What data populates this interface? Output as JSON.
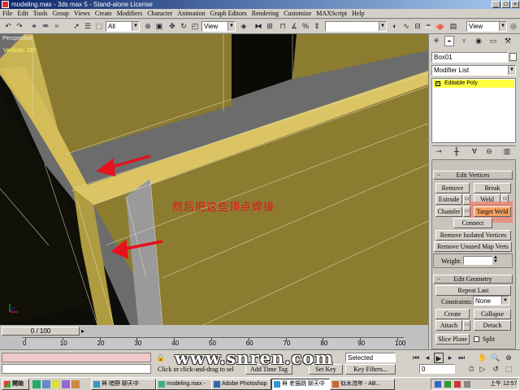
{
  "window": {
    "title": "modeling.max - 3ds max 5 - Stand-alone License"
  },
  "menu": [
    "File",
    "Edit",
    "Tools",
    "Group",
    "Views",
    "Create",
    "Modifiers",
    "Character",
    "Animation",
    "Graph Editors",
    "Rendering",
    "Customize",
    "MAXScript",
    "Help"
  ],
  "toolbar": {
    "selection_filter": "All",
    "ref_coord": "View",
    "named_sel": "",
    "view_dropdown": "View"
  },
  "viewport": {
    "label": "Perspective",
    "vertex_count": "Vertices: 167",
    "annotation": "然后把这些顶点焊接"
  },
  "panel": {
    "object_name": "Box01",
    "modifier_list": "Modifier List",
    "stack_item": "Editable Poly",
    "edit_vertices": {
      "header": "Edit Vertices",
      "remove": "Remove",
      "break": "Break",
      "extrude": "Extrude",
      "weld": "Weld",
      "chamfer": "Chamfer",
      "target_weld": "Target Weld",
      "connect": "Connect",
      "remove_isolated": "Remove Isolated Vertices",
      "remove_unused": "Remove Unused Map Verts",
      "weight_label": "Weight:"
    },
    "edit_geometry": {
      "header": "Edit Geometry",
      "repeat_last": "Repeat Last",
      "constraints_label": "Constraints:",
      "constraints_value": "None",
      "create": "Create",
      "collapse": "Collapse",
      "attach": "Attach",
      "detach": "Detach",
      "slice_plane": "Slice Plane",
      "split": "Split"
    }
  },
  "timeline": {
    "slider": "0 / 100",
    "ticks": [
      "0",
      "10",
      "20",
      "30",
      "40",
      "50",
      "60",
      "70",
      "80",
      "90",
      "100"
    ]
  },
  "status": {
    "prompt": "Click or click-and-drag to sel",
    "add_time_tag": "Add Time Tag",
    "selected": "Selected",
    "set_key": "Set Key",
    "key_filters": "Key Filters...",
    "frame": "0"
  },
  "taskbar": {
    "start": "開始",
    "items": [
      "與 暗野 聊天中",
      "modeling.max -",
      "Adobe Photoshop",
      "與 老猫跳 聊天中",
      "似水流年 - AB..."
    ],
    "clock": "上午 12:57"
  },
  "watermark": "www.snren.com",
  "colors": {
    "wood": "#8c7c30",
    "wood_top": "#d8c060",
    "annotation_red": "#e8101c",
    "highlight": "#f08070",
    "titlebar": "#0a246a"
  }
}
